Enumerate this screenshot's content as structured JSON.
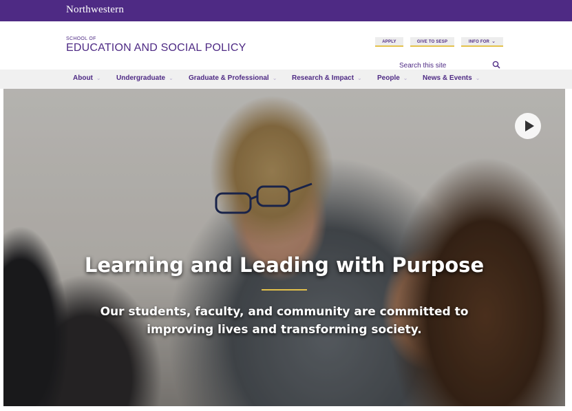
{
  "brand": {
    "university": "Northwestern",
    "school_small": "SCHOOL OF",
    "school_name": "EDUCATION AND SOCIAL POLICY"
  },
  "utility_nav": {
    "apply": "APPLY",
    "give": "GIVE TO SESP",
    "info": "INFO FOR"
  },
  "search": {
    "placeholder": "Search this site",
    "icon": "search-icon"
  },
  "nav": {
    "items": [
      {
        "label": "About"
      },
      {
        "label": "Undergraduate"
      },
      {
        "label": "Graduate & Professional"
      },
      {
        "label": "Research & Impact"
      },
      {
        "label": "People"
      },
      {
        "label": "News & Events"
      }
    ]
  },
  "hero": {
    "title": "Learning and Leading with Purpose",
    "subtitle": "Our students, faculty, and community are committed to improving lives and transforming society.",
    "play_icon": "play-icon"
  },
  "colors": {
    "brand_purple": "#4e2a84",
    "accent_gold": "#e4c24b",
    "nav_bg": "#f0f0f0"
  }
}
